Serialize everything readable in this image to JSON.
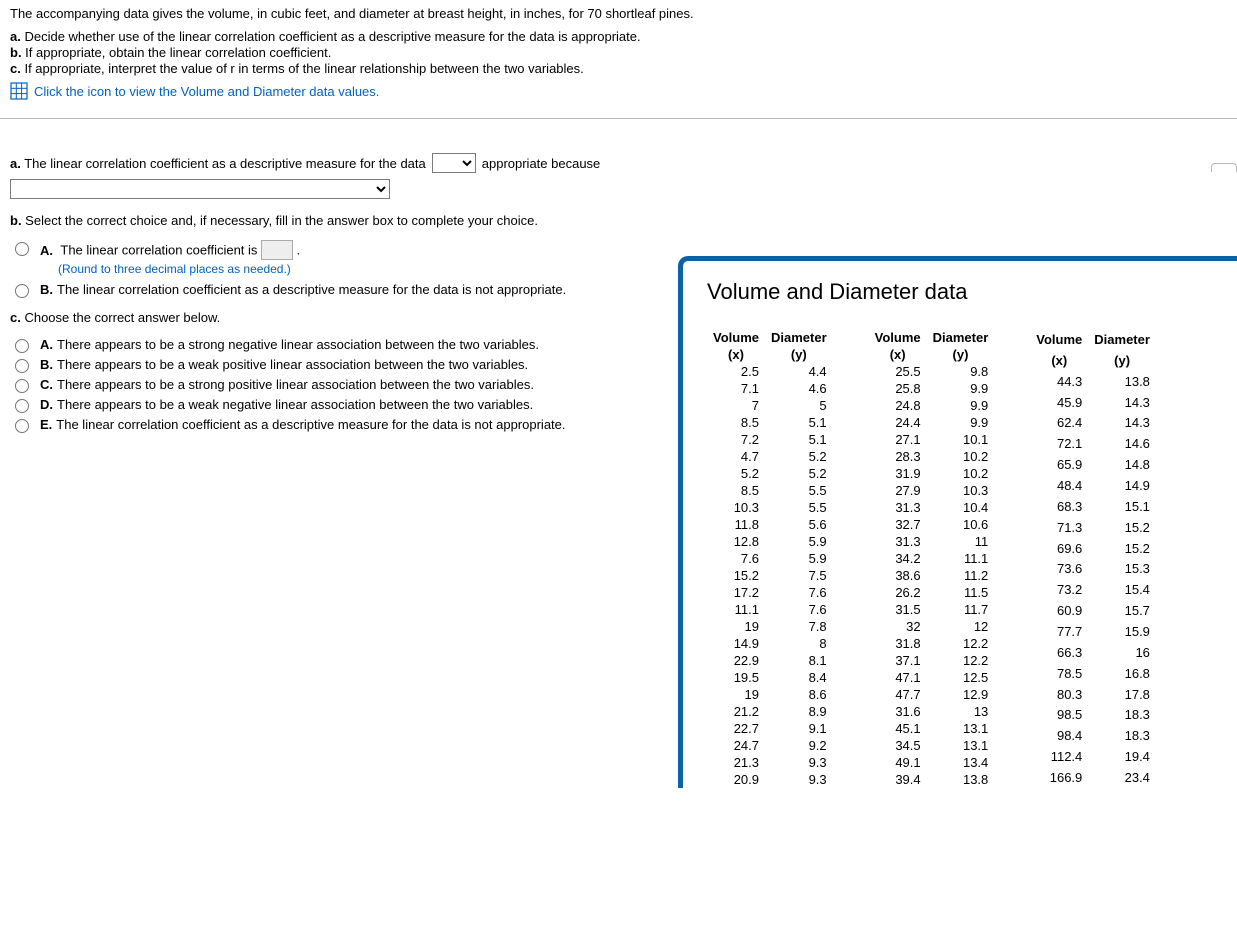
{
  "intro": "The accompanying data gives the volume, in cubic feet, and diameter at breast height, in inches, for 70 shortleaf pines.",
  "parts": {
    "a_label": "a.",
    "a_text": " Decide whether use of the linear correlation coefficient as a descriptive measure for the data is appropriate.",
    "b_label": "b.",
    "b_text": " If appropriate, obtain the linear correlation coefficient.",
    "c_label": "c.",
    "c_text": " If appropriate, interpret the value of r in terms of the linear relationship between the two variables."
  },
  "icon_text": "Click the icon to view the Volume and Diameter data values.",
  "qa": {
    "a_lead": "a.",
    "a_pre": " The linear correlation coefficient as a descriptive measure for the data ",
    "a_mid": " appropriate because ",
    "b_lead": "b.",
    "b_text": " Select the correct choice and, if necessary, fill in the answer box to complete your choice.",
    "c_lead": "c.",
    "c_text": " Choose the correct answer below."
  },
  "b_choices": {
    "A": {
      "letter": "A.",
      "pre": "The linear correlation coefficient is ",
      "post": "."
    },
    "A_hint": "(Round to three decimal places as needed.)",
    "B": {
      "letter": "B.",
      "text": "The linear correlation coefficient as a descriptive measure for the data is not appropriate."
    }
  },
  "c_choices": {
    "A": {
      "letter": "A.",
      "text": "There appears to be a strong negative linear association between the two variables."
    },
    "B": {
      "letter": "B.",
      "text": "There appears to be a weak positive linear association between the two variables."
    },
    "C": {
      "letter": "C.",
      "text": "There appears to be a strong positive linear association between the two variables."
    },
    "D": {
      "letter": "D.",
      "text": "There appears to be a weak negative linear association between the two variables."
    },
    "E": {
      "letter": "E.",
      "text": "The linear correlation coefficient as a descriptive measure for the data is not appropriate."
    }
  },
  "panel_title": "Volume and Diameter data",
  "headers": {
    "vol": "Volume",
    "dia": "Diameter",
    "x": "(x)",
    "y": "(y)"
  },
  "chart_data": {
    "type": "table",
    "title": "Volume and Diameter data",
    "columns": [
      "Volume (x)",
      "Diameter (y)"
    ],
    "blocks": [
      [
        [
          2.5,
          4.4
        ],
        [
          7.1,
          4.6
        ],
        [
          7,
          5
        ],
        [
          8.5,
          5.1
        ],
        [
          7.2,
          5.1
        ],
        [
          4.7,
          5.2
        ],
        [
          5.2,
          5.2
        ],
        [
          8.5,
          5.5
        ],
        [
          10.3,
          5.5
        ],
        [
          11.8,
          5.6
        ],
        [
          12.8,
          5.9
        ],
        [
          7.6,
          5.9
        ],
        [
          15.2,
          7.5
        ],
        [
          17.2,
          7.6
        ],
        [
          11.1,
          7.6
        ],
        [
          19,
          7.8
        ],
        [
          14.9,
          8
        ],
        [
          22.9,
          8.1
        ],
        [
          19.5,
          8.4
        ],
        [
          19,
          8.6
        ],
        [
          21.2,
          8.9
        ],
        [
          22.7,
          9.1
        ],
        [
          24.7,
          9.2
        ],
        [
          21.3,
          9.3
        ],
        [
          20.9,
          9.3
        ]
      ],
      [
        [
          25.5,
          9.8
        ],
        [
          25.8,
          9.9
        ],
        [
          24.8,
          9.9
        ],
        [
          24.4,
          9.9
        ],
        [
          27.1,
          10.1
        ],
        [
          28.3,
          10.2
        ],
        [
          31.9,
          10.2
        ],
        [
          27.9,
          10.3
        ],
        [
          31.3,
          10.4
        ],
        [
          32.7,
          10.6
        ],
        [
          31.3,
          11
        ],
        [
          34.2,
          11.1
        ],
        [
          38.6,
          11.2
        ],
        [
          26.2,
          11.5
        ],
        [
          31.5,
          11.7
        ],
        [
          32,
          12
        ],
        [
          31.8,
          12.2
        ],
        [
          37.1,
          12.2
        ],
        [
          47.1,
          12.5
        ],
        [
          47.7,
          12.9
        ],
        [
          31.6,
          13
        ],
        [
          45.1,
          13.1
        ],
        [
          34.5,
          13.1
        ],
        [
          49.1,
          13.4
        ],
        [
          39.4,
          13.8
        ]
      ],
      [
        [
          44.3,
          13.8
        ],
        [
          45.9,
          14.3
        ],
        [
          62.4,
          14.3
        ],
        [
          72.1,
          14.6
        ],
        [
          65.9,
          14.8
        ],
        [
          48.4,
          14.9
        ],
        [
          68.3,
          15.1
        ],
        [
          71.3,
          15.2
        ],
        [
          69.6,
          15.2
        ],
        [
          73.6,
          15.3
        ],
        [
          73.2,
          15.4
        ],
        [
          60.9,
          15.7
        ],
        [
          77.7,
          15.9
        ],
        [
          66.3,
          16
        ],
        [
          78.5,
          16.8
        ],
        [
          80.3,
          17.8
        ],
        [
          98.5,
          18.3
        ],
        [
          98.4,
          18.3
        ],
        [
          112.4,
          19.4
        ],
        [
          166.9,
          23.4
        ]
      ]
    ]
  }
}
